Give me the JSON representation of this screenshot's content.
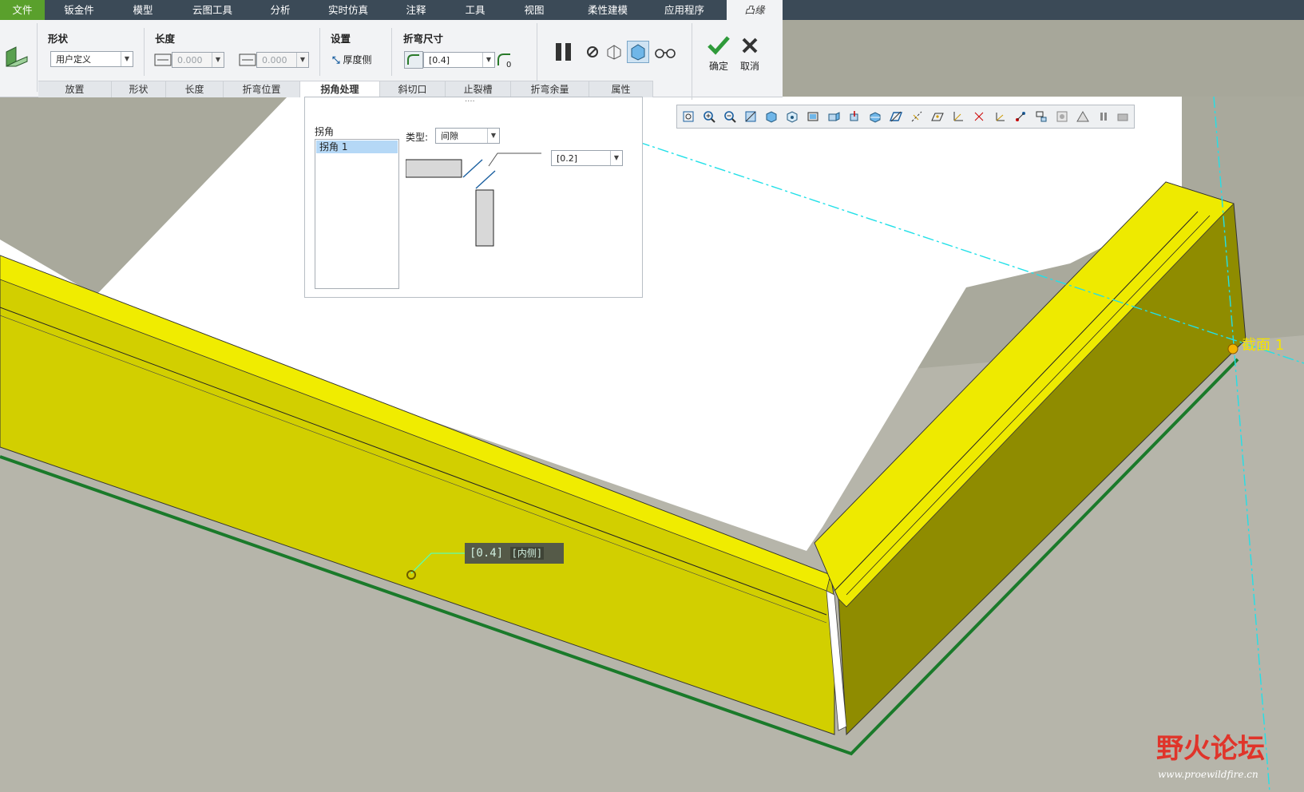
{
  "tabs": [
    "文件",
    "钣金件",
    "模型",
    "云图工具",
    "分析",
    "实时仿真",
    "注释",
    "工具",
    "视图",
    "柔性建模",
    "应用程序",
    "凸缘"
  ],
  "ribbon": {
    "shape": {
      "title": "形状",
      "value": "用户定义"
    },
    "length": {
      "title": "长度",
      "value1": "0.000",
      "value2": "0.000"
    },
    "settings": {
      "title": "设置",
      "thickness_label": "厚度侧"
    },
    "bend": {
      "title": "折弯尺寸",
      "value": "[0.4]"
    },
    "ok_label": "确定",
    "cancel_label": "取消"
  },
  "subtabs": [
    "放置",
    "形状",
    "长度",
    "折弯位置",
    "拐角处理",
    "斜切口",
    "止裂槽",
    "折弯余量",
    "属性"
  ],
  "panel": {
    "corner_title": "拐角",
    "list_item": "拐角 1",
    "type_label": "类型:",
    "type_value": "间隙",
    "gap_value": "[0.2]",
    "dots": "····"
  },
  "annotation": {
    "value": "[0.4]",
    "side": "[内侧]"
  },
  "section_label": "截面 1",
  "watermark": {
    "text": "野火论坛",
    "url": "www.proewildfire.cn"
  },
  "colors": {
    "yellow": "#f0ec00",
    "green": "#1a7a2a",
    "accent_green": "#5aa02c"
  }
}
